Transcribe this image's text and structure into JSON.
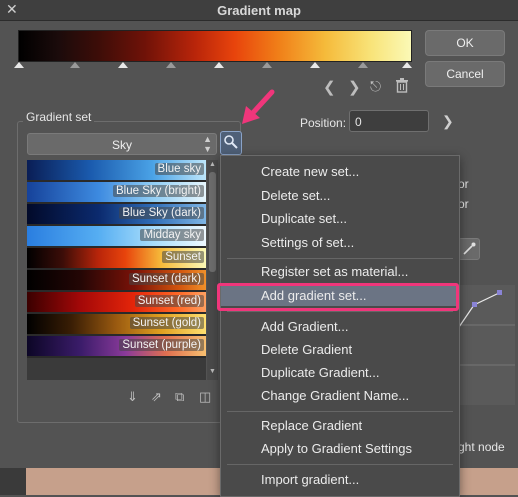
{
  "window": {
    "title": "Gradient map",
    "close_label": "✕"
  },
  "buttons": {
    "ok": "OK",
    "cancel": "Cancel"
  },
  "position": {
    "label": "Position:",
    "value": "0"
  },
  "gradient_set": {
    "label": "Gradient set",
    "selected": "Sky",
    "items": [
      {
        "label": "Blue sky"
      },
      {
        "label": "Blue Sky (bright)"
      },
      {
        "label": "Blue Sky (dark)"
      },
      {
        "label": "Midday sky"
      },
      {
        "label": "Sunset"
      },
      {
        "label": "Sunset (dark)"
      },
      {
        "label": "Sunset (red)"
      },
      {
        "label": "Sunset (gold)"
      },
      {
        "label": "Sunset (purple)"
      }
    ]
  },
  "right_panel": {
    "or1": "or",
    "or2": "or",
    "ht_node": "ght node"
  },
  "context_menu": {
    "items": [
      "Create new set...",
      "Delete set...",
      "Duplicate set...",
      "Settings of set...",
      "Register set as material...",
      "Add gradient set...",
      "Add Gradient...",
      "Delete Gradient",
      "Duplicate Gradient...",
      "Change Gradient Name...",
      "Replace Gradient",
      "Apply to Gradient Settings",
      "Import gradient..."
    ],
    "selected_index": 5
  },
  "colors": {
    "highlight": "#f0367b",
    "accent": "#8aa3c8"
  }
}
